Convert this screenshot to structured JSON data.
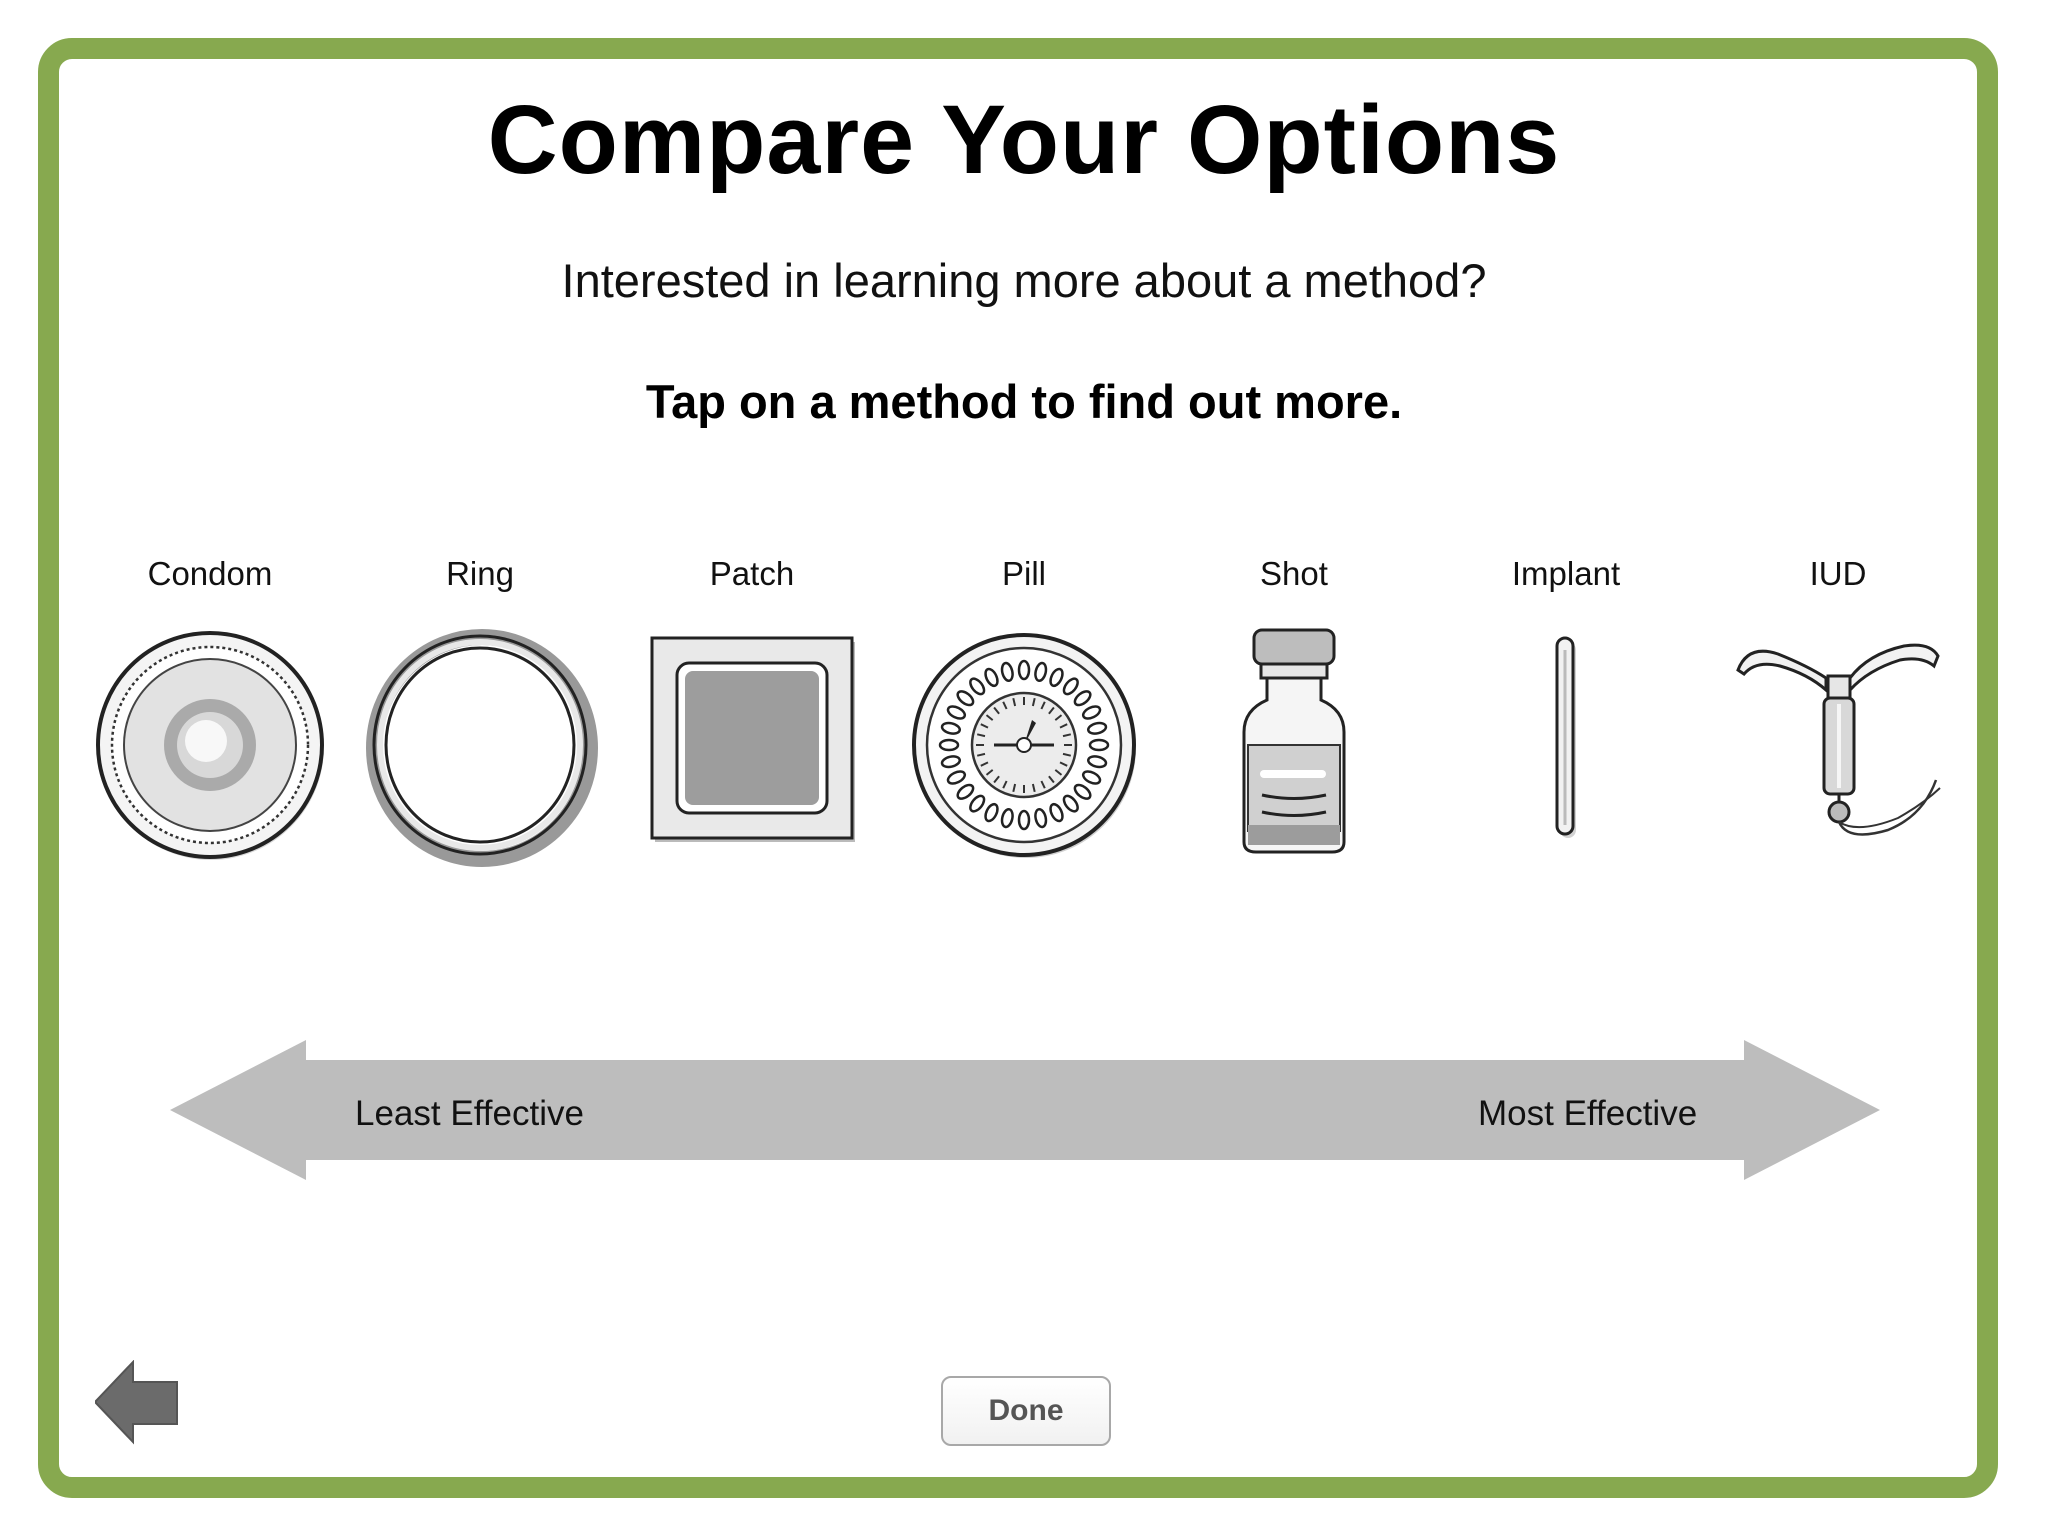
{
  "header": {
    "title": "Compare Your Options",
    "subtitle": "Interested in learning more about a method?",
    "instruction": "Tap on a method to find out more."
  },
  "methods": [
    {
      "label": "Condom",
      "icon": "condom-icon"
    },
    {
      "label": "Ring",
      "icon": "ring-icon"
    },
    {
      "label": "Patch",
      "icon": "patch-icon"
    },
    {
      "label": "Pill",
      "icon": "pill-pack-icon"
    },
    {
      "label": "Shot",
      "icon": "vial-icon"
    },
    {
      "label": "Implant",
      "icon": "implant-rod-icon"
    },
    {
      "label": "IUD",
      "icon": "iud-icon"
    }
  ],
  "effectiveness_scale": {
    "left_label": "Least Effective",
    "right_label": "Most Effective"
  },
  "footer": {
    "done_label": "Done",
    "back_icon": "back-arrow-icon"
  },
  "colors": {
    "frame": "#87a94f",
    "arrow": "#bdbdbd",
    "back_arrow": "#6b6b6b"
  }
}
